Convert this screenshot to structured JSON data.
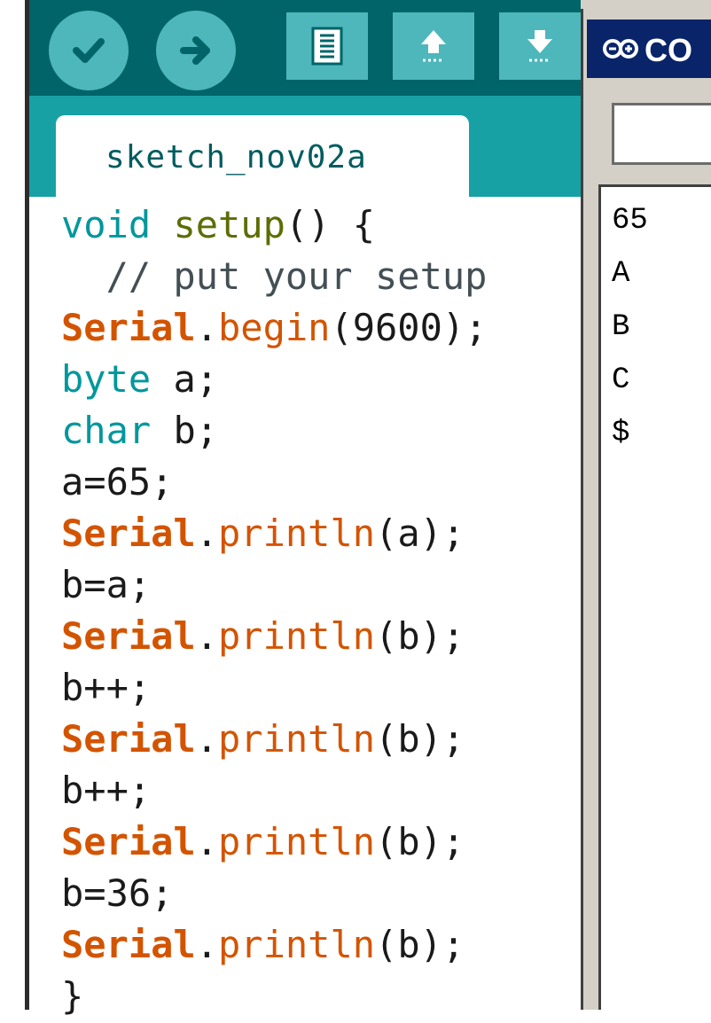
{
  "ide": {
    "toolbar": {
      "verify_icon": "check-icon",
      "upload_icon": "arrow-right-icon",
      "new_icon": "document-icon",
      "open_icon": "arrow-up-icon",
      "save_icon": "arrow-down-icon"
    },
    "tab_label": "sketch_nov02a",
    "code_lines": [
      [
        {
          "t": "void",
          "c": "kw-teal"
        },
        {
          "t": " ",
          "c": ""
        },
        {
          "t": "setup",
          "c": "kw-green"
        },
        {
          "t": "() {",
          "c": ""
        }
      ],
      [
        {
          "t": "  // put your setup",
          "c": "kw-cmt"
        }
      ],
      [
        {
          "t": "Serial",
          "c": "kw-serial"
        },
        {
          "t": ".",
          "c": ""
        },
        {
          "t": "begin",
          "c": "kw-fn"
        },
        {
          "t": "(9600);",
          "c": ""
        }
      ],
      [
        {
          "t": "byte",
          "c": "kw-teal"
        },
        {
          "t": " a;",
          "c": ""
        }
      ],
      [
        {
          "t": "char",
          "c": "kw-teal"
        },
        {
          "t": " b;",
          "c": ""
        }
      ],
      [
        {
          "t": "a=65;",
          "c": ""
        }
      ],
      [
        {
          "t": "Serial",
          "c": "kw-serial"
        },
        {
          "t": ".",
          "c": ""
        },
        {
          "t": "println",
          "c": "kw-fn"
        },
        {
          "t": "(a);",
          "c": ""
        }
      ],
      [
        {
          "t": "b=a;",
          "c": ""
        }
      ],
      [
        {
          "t": "Serial",
          "c": "kw-serial"
        },
        {
          "t": ".",
          "c": ""
        },
        {
          "t": "println",
          "c": "kw-fn"
        },
        {
          "t": "(b);",
          "c": ""
        }
      ],
      [
        {
          "t": "b++;",
          "c": ""
        }
      ],
      [
        {
          "t": "Serial",
          "c": "kw-serial"
        },
        {
          "t": ".",
          "c": ""
        },
        {
          "t": "println",
          "c": "kw-fn"
        },
        {
          "t": "(b);",
          "c": ""
        }
      ],
      [
        {
          "t": "b++;",
          "c": ""
        }
      ],
      [
        {
          "t": "Serial",
          "c": "kw-serial"
        },
        {
          "t": ".",
          "c": ""
        },
        {
          "t": "println",
          "c": "kw-fn"
        },
        {
          "t": "(b);",
          "c": ""
        }
      ],
      [
        {
          "t": "b=36;",
          "c": ""
        }
      ],
      [
        {
          "t": "Serial",
          "c": "kw-serial"
        },
        {
          "t": ".",
          "c": ""
        },
        {
          "t": "println",
          "c": "kw-fn"
        },
        {
          "t": "(b);",
          "c": ""
        }
      ],
      [
        {
          "t": "}",
          "c": ""
        }
      ]
    ]
  },
  "monitor": {
    "title": "CO",
    "title_icon": "arduino-logo-icon",
    "input_value": "",
    "output_lines": [
      "65",
      "A",
      "B",
      "C",
      "$"
    ]
  },
  "colors": {
    "toolbar_dark": "#006468",
    "tabbar_teal": "#17a1a5",
    "button_teal": "#4db7bb",
    "keyword_orange": "#d35400",
    "keyword_teal": "#00979c"
  }
}
